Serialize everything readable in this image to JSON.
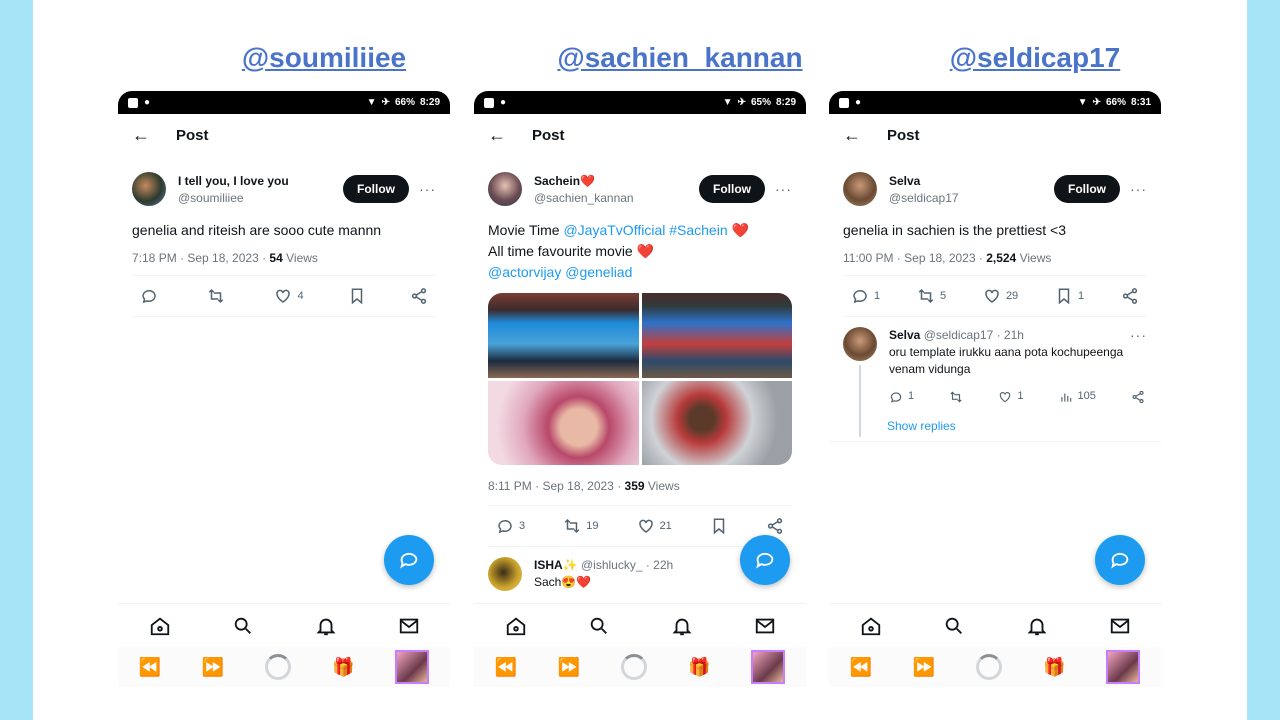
{
  "columns": [
    {
      "title": "@soumiliiee",
      "status": {
        "battery": "66%",
        "time": "8:29"
      },
      "header": {
        "title": "Post"
      },
      "author": {
        "name": "I tell you, I love you",
        "handle": "@soumiliiee",
        "follow": "Follow"
      },
      "tweet": {
        "text": "genelia and riteish are sooo cute mannn"
      },
      "meta": {
        "time": "7:18 PM · Sep 18, 2023 · ",
        "views": "54",
        "views_label": " Views"
      },
      "stats": {
        "replies": "",
        "retweets": "",
        "likes": "4"
      }
    },
    {
      "title": "@sachien_kannan",
      "status": {
        "battery": "65%",
        "time": "8:29"
      },
      "header": {
        "title": "Post"
      },
      "author": {
        "name": "Sachein❤️",
        "handle": "@sachien_kannan",
        "follow": "Follow"
      },
      "tweet": {
        "line1": "Movie Time ",
        "mention1": "@JayaTvOfficial",
        "hashtag": "#Sachein",
        "line1_end": " ❤️",
        "line2": "All time favourite movie ❤️",
        "mention2": "@actorvijay",
        "mention3": "@geneliad"
      },
      "meta": {
        "time": "8:11 PM · Sep 18, 2023 · ",
        "views": "359",
        "views_label": " Views"
      },
      "stats": {
        "replies": "3",
        "retweets": "19",
        "likes": "21"
      },
      "reply": {
        "name": "ISHA✨",
        "handle": "@ishlucky_ · 22h",
        "text": "Sach😍❤️"
      }
    },
    {
      "title": "@seldicap17",
      "status": {
        "battery": "66%",
        "time": "8:31"
      },
      "header": {
        "title": "Post"
      },
      "author": {
        "name": "Selva",
        "handle": "@seldicap17",
        "follow": "Follow"
      },
      "tweet": {
        "text": "genelia in sachien is the prettiest <3"
      },
      "meta": {
        "time": "11:00 PM · Sep 18, 2023 · ",
        "views": "2,524",
        "views_label": " Views"
      },
      "stats": {
        "replies": "1",
        "retweets": "5",
        "likes": "29",
        "bookmarks": "1"
      },
      "reply": {
        "name": "Selva",
        "handle": " @seldicap17 · 21h",
        "text": "oru template irukku aana pota kochupeenga venam vidunga",
        "replies": "1",
        "likes": "1",
        "views": "105",
        "show_replies": "Show replies"
      }
    }
  ],
  "colors": {
    "accent": "#1d9bf0",
    "title": "#4a74c9",
    "background": "#a6e4f7"
  }
}
